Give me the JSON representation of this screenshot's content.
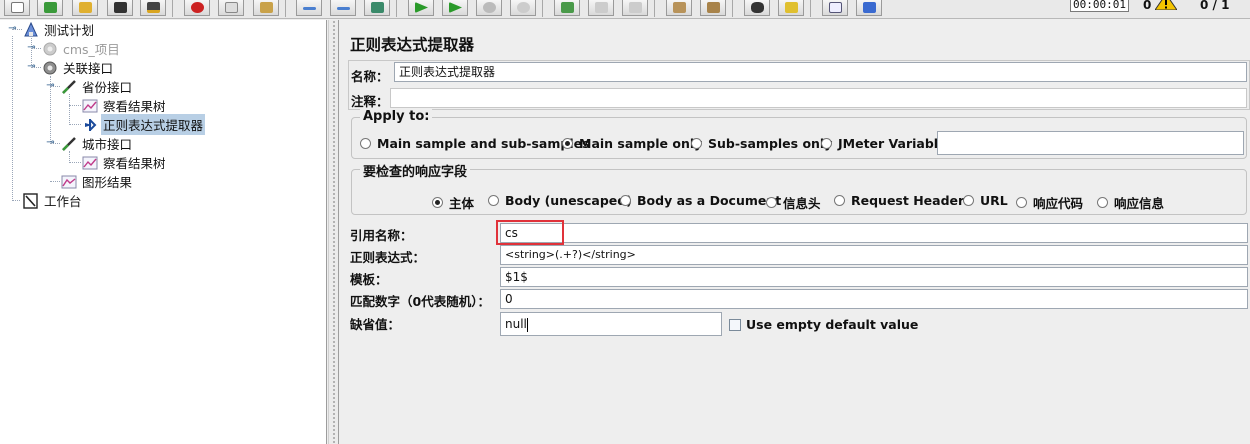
{
  "toolbar": {
    "buttons": [
      "new-icon",
      "templates-icon",
      "open-icon",
      "save-icon",
      "save-as-icon",
      "cut-icon",
      "copy-icon",
      "paste-icon",
      "expand-icon",
      "collapse-icon",
      "toggle-icon",
      "start-icon",
      "start-no-pause-icon",
      "stop-icon",
      "shutdown-icon",
      "remote-start-icon",
      "remote-stop-icon",
      "remote-shutdown-icon",
      "clear-icon",
      "clear-all-icon",
      "search-icon",
      "reset-search-icon",
      "function-helper-icon",
      "help-icon"
    ],
    "timer": "00:00:01",
    "error_count": "0",
    "threads": "0 / 1"
  },
  "tree": {
    "nodes": [
      {
        "label": "测试计划",
        "icon": "test-plan-icon"
      },
      {
        "label": "cms_项目",
        "icon": "thread-group-icon",
        "disabled": true
      },
      {
        "label": "关联接口",
        "icon": "thread-group-icon"
      },
      {
        "label": "省份接口",
        "icon": "http-sampler-icon"
      },
      {
        "label": "察看结果树",
        "icon": "listener-icon"
      },
      {
        "label": "正则表达式提取器",
        "icon": "post-processor-icon",
        "selected": true
      },
      {
        "label": "城市接口",
        "icon": "http-sampler-icon"
      },
      {
        "label": "察看结果树",
        "icon": "listener-icon"
      },
      {
        "label": "图形结果",
        "icon": "graph-icon"
      },
      {
        "label": "工作台",
        "icon": "workbench-icon"
      }
    ]
  },
  "panel": {
    "title": "正则表达式提取器",
    "name_label": "名称：",
    "name_value": "正则表达式提取器",
    "comment_label": "注释：",
    "comment_value": "",
    "apply_to": {
      "title": "Apply to:",
      "options": [
        "Main sample and sub-samples",
        "Main sample only",
        "Sub-samples only",
        "JMeter Variable"
      ],
      "selected": "Main sample only",
      "variable_value": ""
    },
    "field_to_check": {
      "title": "要检查的响应字段",
      "options": [
        "主体",
        "Body (unescaped)",
        "Body as a Document",
        "信息头",
        "Request Headers",
        "URL",
        "响应代码",
        "响应信息"
      ],
      "selected": "主体"
    },
    "ref_name_label": "引用名称：",
    "ref_name_value": "cs",
    "regex_label": "正则表达式：",
    "regex_value": "<string>(.+?)</string>",
    "template_label": "模板：",
    "template_value": "$1$",
    "match_no_label": "匹配数字（0代表随机）：",
    "match_no_value": "0",
    "default_label": "缺省值：",
    "default_value": "null",
    "use_empty_default_label": "Use empty default value",
    "use_empty_default_checked": false
  }
}
